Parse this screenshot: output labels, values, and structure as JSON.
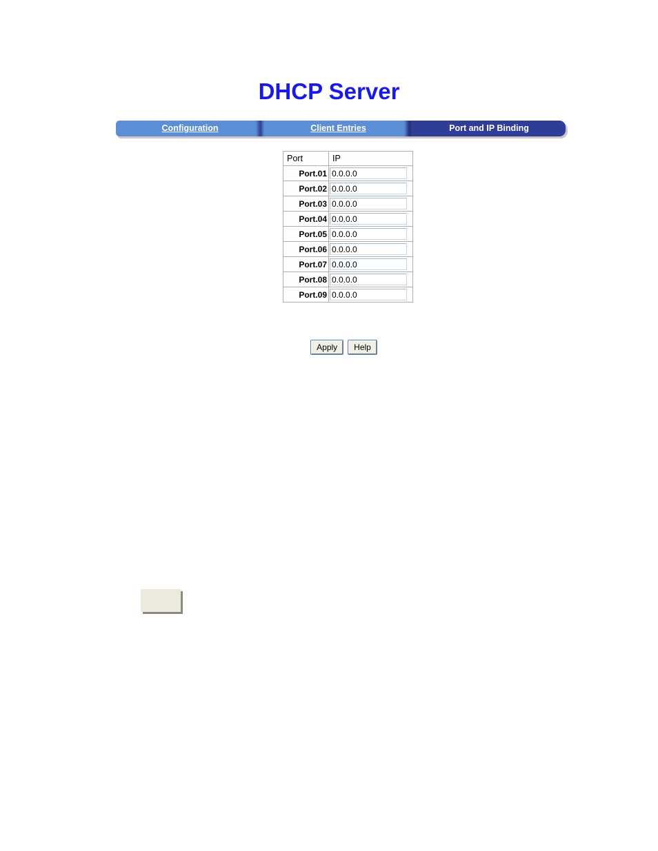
{
  "page": {
    "title": "DHCP Server",
    "title_color": "#1a1ae6"
  },
  "tabs": {
    "active_index": 2,
    "inactive_color": "#5b8ed4",
    "active_color": "#2f3d96",
    "items": [
      {
        "label": "Configuration",
        "active": false
      },
      {
        "label": "Client Entries",
        "active": false
      },
      {
        "label": "Port and IP Binding",
        "active": true
      }
    ]
  },
  "table": {
    "headers": [
      "Port",
      "IP"
    ],
    "rows": [
      {
        "port": "Port.01",
        "ip": "0.0.0.0"
      },
      {
        "port": "Port.02",
        "ip": "0.0.0.0"
      },
      {
        "port": "Port.03",
        "ip": "0.0.0.0"
      },
      {
        "port": "Port.04",
        "ip": "0.0.0.0"
      },
      {
        "port": "Port.05",
        "ip": "0.0.0.0"
      },
      {
        "port": "Port.06",
        "ip": "0.0.0.0"
      },
      {
        "port": "Port.07",
        "ip": "0.0.0.0"
      },
      {
        "port": "Port.08",
        "ip": "0.0.0.0"
      },
      {
        "port": "Port.09",
        "ip": "0.0.0.0"
      }
    ]
  },
  "buttons": {
    "apply_label": "Apply",
    "help_label": "Help"
  },
  "bottom_box": {
    "label": "",
    "color": "#ece9dd"
  }
}
